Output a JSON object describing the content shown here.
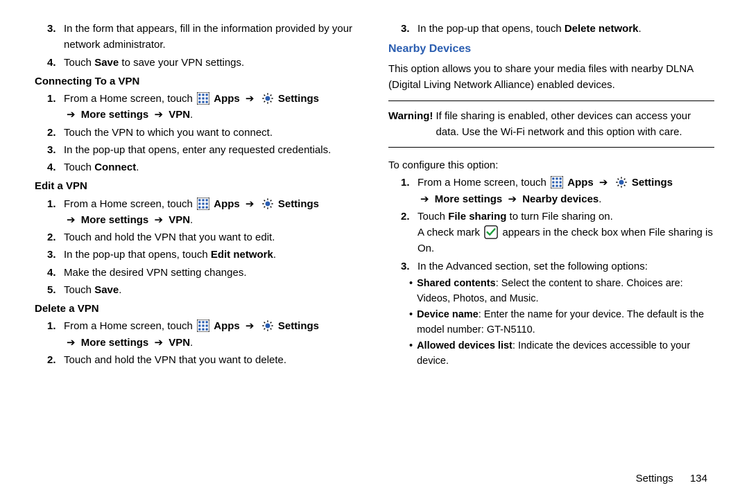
{
  "left": {
    "item3": "In the form that appears, fill in the information provided by your network administrator.",
    "item4_pre": "Touch ",
    "item4_b": "Save",
    "item4_post": " to save your VPN settings.",
    "h_connect": "Connecting To a VPN",
    "conn1_pre": "From a Home screen, touch ",
    "conn1_apps": "Apps",
    "conn1_settings": "Settings",
    "conn1_line2_more": "More settings",
    "conn1_line2_vpn": "VPN",
    "conn2": "Touch the VPN to which you want to connect.",
    "conn3": "In the pop-up that opens, enter any requested credentials.",
    "conn4_pre": "Touch ",
    "conn4_b": "Connect",
    "h_edit": "Edit a VPN",
    "edit1_pre": "From a Home screen, touch ",
    "edit1_apps": "Apps",
    "edit1_settings": "Settings",
    "edit1_more": "More settings",
    "edit1_vpn": "VPN",
    "edit2": "Touch and hold the VPN that you want to edit.",
    "edit3_pre": "In the pop-up that opens, touch ",
    "edit3_b": "Edit network",
    "edit4": "Make the desired VPN setting changes.",
    "edit5_pre": "Touch ",
    "edit5_b": "Save",
    "h_del": "Delete a VPN",
    "del1_pre": "From a Home screen, touch ",
    "del1_apps": "Apps",
    "del1_settings": "Settings",
    "del1_more": "More settings",
    "del1_vpn": "VPN",
    "del2": "Touch and hold the VPN that you want to delete."
  },
  "right": {
    "item3_pre": "In the pop-up that opens, touch ",
    "item3_b": "Delete network",
    "h_nearby": "Nearby Devices",
    "nearby_desc": "This option allows you to share your media files with nearby DLNA (Digital Living Network Alliance) enabled devices.",
    "warn_label": "Warning!",
    "warn_text": "If file sharing is enabled, other devices can access your data. Use the Wi-Fi network and this option with care.",
    "conf_intro": "To configure this option:",
    "c1_pre": "From a Home screen, touch ",
    "c1_apps": "Apps",
    "c1_settings": "Settings",
    "c1_more": "More settings",
    "c1_nearby": "Nearby devices",
    "c2_pre": "Touch ",
    "c2_b": "File sharing",
    "c2_post": " to turn File sharing on.",
    "c2_l2a": "A check mark ",
    "c2_l2b": " appears in the check box when File sharing is On.",
    "c3": "In the Advanced section, set the following options:",
    "b1_b": "Shared contents",
    "b1_t": ": Select the content to share. Choices are: Videos, Photos, and Music.",
    "b2_b": "Device name",
    "b2_t": ": Enter the name for your device. The default is the model number: GT-N5110.",
    "b3_b": "Allowed devices list",
    "b3_t": ": Indicate the devices accessible to your device."
  },
  "footer": {
    "label": "Settings",
    "page": "134"
  },
  "arrow": "➔"
}
